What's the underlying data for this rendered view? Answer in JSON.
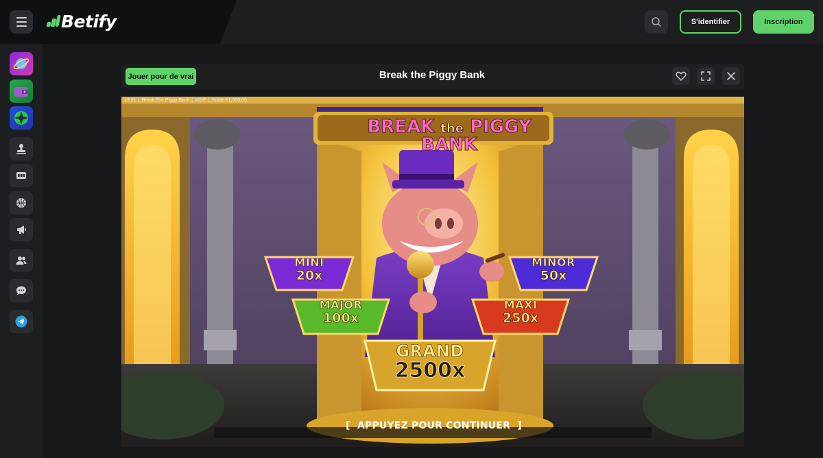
{
  "header": {
    "brand": "Betify",
    "login_label": "S'identifier",
    "signup_label": "Inscription",
    "accent_color": "#5fd369"
  },
  "sidebar": {
    "items": [
      {
        "icon": "casino-promo-thumb"
      },
      {
        "icon": "wallet-promo-thumb"
      },
      {
        "icon": "wheel-promo-thumb"
      },
      {
        "icon": "stamp-icon"
      },
      {
        "icon": "slot-machine-icon"
      },
      {
        "icon": "basketball-icon"
      },
      {
        "icon": "megaphone-icon"
      },
      {
        "icon": "users-icon"
      },
      {
        "icon": "chat-icon"
      },
      {
        "icon": "telegram-icon"
      }
    ]
  },
  "game": {
    "play_real_label": "Jouer pour de vrai",
    "title": "Break the Piggy Bank",
    "info": {
      "time": "13:31",
      "name": "Break The Piggy Bank",
      "help": "AIDE",
      "balance": "Solde  €1,000.00"
    },
    "logo": {
      "part1": "BREAK",
      "part2": "the",
      "part3": "PIGGY BANK"
    },
    "jackpots": {
      "mini": {
        "name": "MINI",
        "value": "20x"
      },
      "minor": {
        "name": "MINOR",
        "value": "50x"
      },
      "major": {
        "name": "MAJOR",
        "value": "100x"
      },
      "maxi": {
        "name": "MAXI",
        "value": "250x"
      },
      "grand": {
        "name": "GRAND",
        "value": "2500x"
      }
    },
    "continue_label": "APPUYEZ POUR CONTINUER"
  }
}
